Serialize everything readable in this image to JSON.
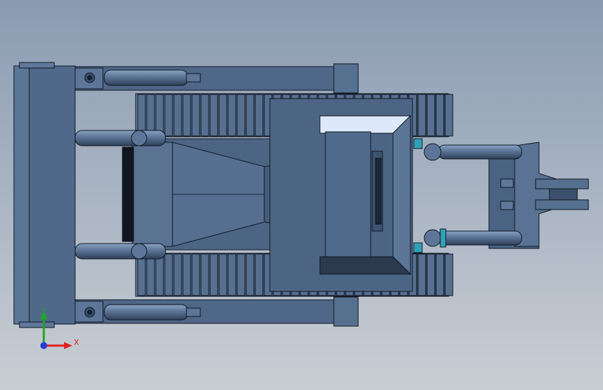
{
  "viewport": {
    "background_top": "#8a9bb2",
    "background_bottom": "#c9ced4",
    "model": {
      "part_fill": "#4f6788",
      "part_light": "#6c85a6",
      "part_dark": "#2f3f54",
      "edge": "#0e1622",
      "glass": "#dde9fb",
      "accent_teal": "#2ea3b8"
    }
  },
  "triad": {
    "x_label": "X",
    "y_label": "Y",
    "x_color": "#e02020",
    "y_color": "#1ea81e",
    "origin_color": "#2a3bd6"
  }
}
